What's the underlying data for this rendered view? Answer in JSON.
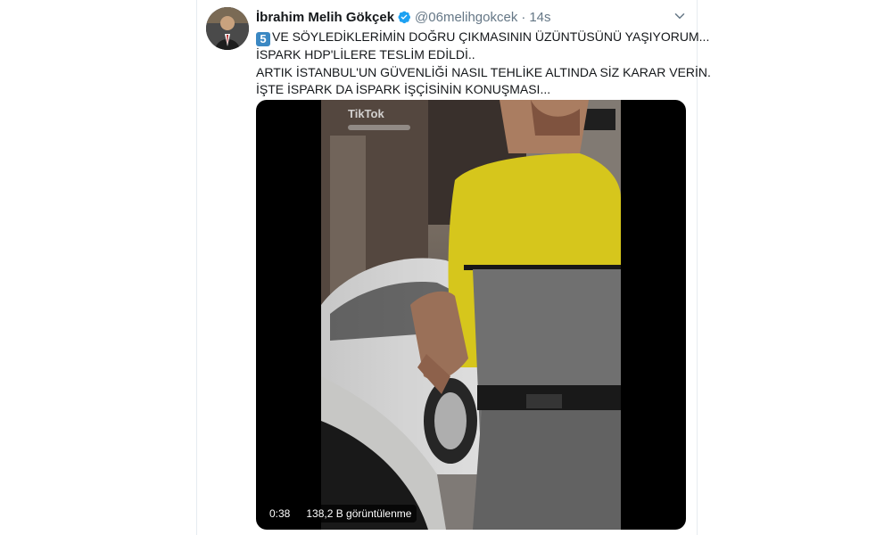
{
  "tweet": {
    "author_name": "İbrahim Melih Gökçek",
    "handle": "@06melihgokcek",
    "separator": "·",
    "time": "14s",
    "keycap": "5",
    "lines": [
      "VE SÖYLEDİKLERİMİN DOĞRU ÇIKMASININ ÜZÜNTÜSÜNÜ YAŞIYORUM...",
      "İSPARK HDP'LİLERE TESLİM EDİLDİ..",
      "ARTIK İSTANBUL'UN GÜVENLİĞİ NASIL TEHLİKE ALTINDA SİZ KARAR VERİN.",
      "İŞTE İSPARK DA İSPARK İŞÇİSİNİN KONUŞMASI..."
    ]
  },
  "video": {
    "watermark": "TikTok",
    "duration": "0:38",
    "views": "138,2 B görüntülenme"
  },
  "icons": {
    "verified": "verified-badge-icon",
    "caret": "chevron-down-icon",
    "tiktok": "tiktok-logo-icon"
  },
  "colors": {
    "verified": "#1da1f2",
    "secondary_text": "#657786",
    "keycap": "#3b88c3"
  }
}
